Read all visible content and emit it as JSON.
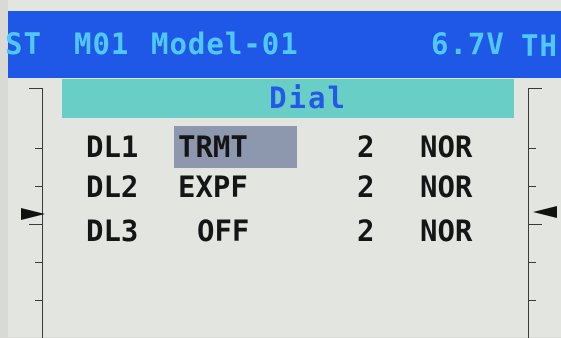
{
  "header": {
    "left_prefix": "ST",
    "model_number": "M01",
    "model_name": "Model-01",
    "voltage": "6.7V",
    "right_prefix": "TH"
  },
  "title": "Dial",
  "rows": [
    {
      "name": "DL1",
      "function": "TRMT",
      "value": "2",
      "direction": "NOR",
      "selected": true
    },
    {
      "name": "DL2",
      "function": "EXPF",
      "value": "2",
      "direction": "NOR",
      "selected": false
    },
    {
      "name": "DL3",
      "function": "OFF",
      "value": "2",
      "direction": "NOR",
      "selected": false
    }
  ],
  "colors": {
    "header_bg": "#1f58e6",
    "header_text": "#50c8ff",
    "title_bg": "#69cfc6",
    "title_text": "#2458e8",
    "selection": "#8d98ae",
    "screen_bg": "#e3e5e1"
  }
}
